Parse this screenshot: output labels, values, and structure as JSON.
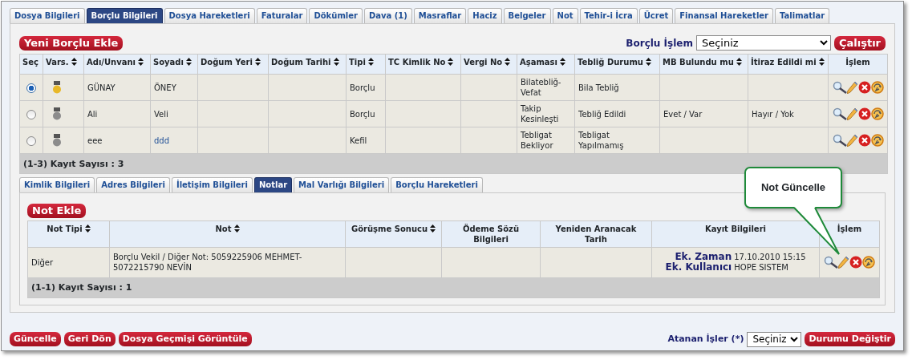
{
  "tabs": [
    {
      "label": "Dosya Bilgileri",
      "selected": false
    },
    {
      "label": "Borçlu Bilgileri",
      "selected": true
    },
    {
      "label": "Dosya Hareketleri",
      "selected": false
    },
    {
      "label": "Faturalar",
      "selected": false
    },
    {
      "label": "Dökümler",
      "selected": false
    },
    {
      "label": "Dava (1)",
      "selected": false
    },
    {
      "label": "Masraflar",
      "selected": false
    },
    {
      "label": "Haciz",
      "selected": false
    },
    {
      "label": "Belgeler",
      "selected": false
    },
    {
      "label": "Not",
      "selected": false
    },
    {
      "label": "Tehir-i İcra",
      "selected": false
    },
    {
      "label": "Ücret",
      "selected": false
    },
    {
      "label": "Finansal Hareketler",
      "selected": false
    },
    {
      "label": "Talimatlar",
      "selected": false
    }
  ],
  "add_debtor_button": "Yeni Borçlu Ekle",
  "debtor_action": {
    "label": "Borçlu İşlem",
    "value": "Seçiniz",
    "button": "Çalıştır"
  },
  "debtors": {
    "columns": [
      {
        "label": "Seç",
        "sortable": false
      },
      {
        "label": "Vars.",
        "sortable": true
      },
      {
        "label": "Adı/Unvanı",
        "sortable": true
      },
      {
        "label": "Soyadı",
        "sortable": true
      },
      {
        "label": "Doğum Yeri",
        "sortable": true
      },
      {
        "label": "Doğum Tarihi",
        "sortable": true
      },
      {
        "label": "Tipi",
        "sortable": true
      },
      {
        "label": "TC Kimlik No",
        "sortable": true
      },
      {
        "label": "Vergi No",
        "sortable": true
      },
      {
        "label": "Aşaması",
        "sortable": true
      },
      {
        "label": "Tebliğ Durumu",
        "sortable": true
      },
      {
        "label": "MB Bulundu mu",
        "sortable": true
      },
      {
        "label": "İtiraz Edildi mi",
        "sortable": true
      },
      {
        "label": "İşlem",
        "sortable": false
      }
    ],
    "rows": [
      {
        "selected": true,
        "color": "#e8b828",
        "name": "GÜNAY",
        "surname": "ÖNEY",
        "type": "Borçlu",
        "stage": "Bilatebliğ-Vefat",
        "notification": "Bila Tebliğ"
      },
      {
        "selected": false,
        "color": "#8c8c8c",
        "name": "Ali",
        "surname": "Veli",
        "type": "Borçlu",
        "stage": "Takip Kesinleşti",
        "notification": "Tebliğ Edildi",
        "mb_found": "Evet / Var",
        "objection": "Hayır / Yok"
      },
      {
        "selected": false,
        "color": "#8c8c8c",
        "name": "eee",
        "surname": "ddd",
        "type": "Kefil",
        "stage": "Tebligat Bekliyor",
        "notification": "Tebligat Yapılmamış"
      }
    ],
    "footer": "(1-3) Kayıt Sayısı : 3"
  },
  "detail_tabs": [
    {
      "label": "Kimlik Bilgileri",
      "selected": false
    },
    {
      "label": "Adres Bilgileri",
      "selected": false
    },
    {
      "label": "İletişim Bilgileri",
      "selected": false
    },
    {
      "label": "Notlar",
      "selected": true
    },
    {
      "label": "Mal Varlığı Bilgileri",
      "selected": false
    },
    {
      "label": "Borçlu Hareketleri",
      "selected": false
    }
  ],
  "notes": {
    "add_button": "Not Ekle",
    "columns": [
      {
        "label": "Not Tipi",
        "sortable": true
      },
      {
        "label": "Not",
        "sortable": true
      },
      {
        "label": "Görüşme Sonucu",
        "sortable": true
      },
      {
        "label": "Ödeme Sözü Bilgileri",
        "sortable": false
      },
      {
        "label": "Yeniden Aranacak Tarih",
        "sortable": false
      },
      {
        "label": "Kayıt Bilgileri",
        "sortable": false
      },
      {
        "label": "İşlem",
        "sortable": false
      }
    ],
    "rows": [
      {
        "note_type": "Diğer",
        "note": "Borçlu Vekil / Diğer Not: 5059225906 MEHMET-5072215790 NEVİN",
        "record": [
          {
            "label": "Ek. Zaman",
            "value": "17.10.2010 15:15"
          },
          {
            "label": "Ek. Kullanıcı",
            "value": "HOPE SISTEM"
          }
        ]
      }
    ],
    "footer": "(1-1) Kayıt Sayısı : 1"
  },
  "callout": "Not Güncelle",
  "bottom_buttons": [
    "Güncelle",
    "Geri Dön",
    "Dosya Geçmişi Görüntüle"
  ],
  "assigned": {
    "label": "Atanan İşler (*)",
    "value": "Seçiniz",
    "button": "Durumu Değiştir"
  }
}
